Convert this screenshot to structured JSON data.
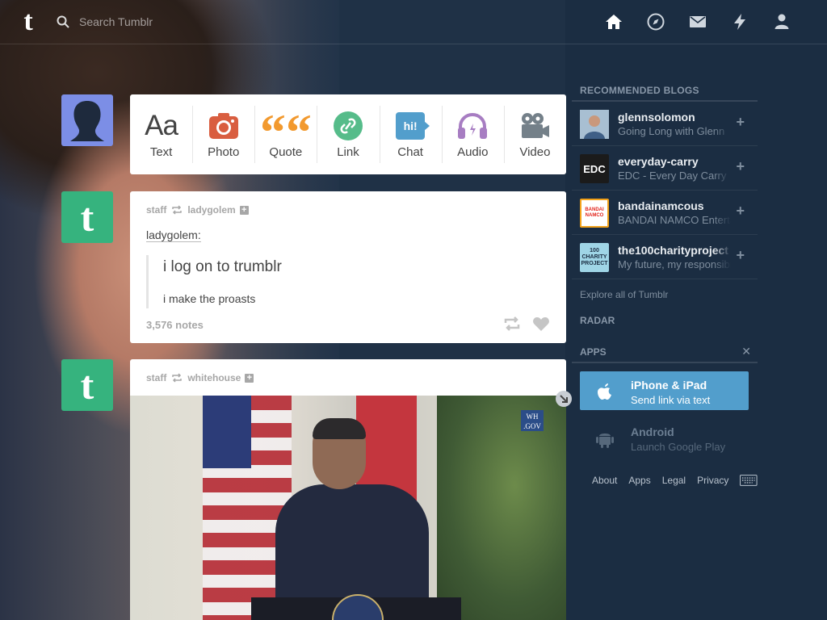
{
  "header": {
    "logo": "t",
    "search_placeholder": "Search Tumblr"
  },
  "nav": [
    "home-icon",
    "explore-icon",
    "inbox-icon",
    "activity-icon",
    "account-icon"
  ],
  "composer": {
    "types": [
      {
        "label": "Text",
        "icon": "Aa",
        "color": "#444444"
      },
      {
        "label": "Photo",
        "color": "#d95e40"
      },
      {
        "label": "Quote",
        "icon": "““",
        "color": "#f2992e"
      },
      {
        "label": "Link",
        "color": "#56bc8a"
      },
      {
        "label": "Chat",
        "icon": "hi!",
        "color": "#529ecc"
      },
      {
        "label": "Audio",
        "color": "#a77dc2"
      },
      {
        "label": "Video",
        "color": "#748089"
      }
    ]
  },
  "posts": [
    {
      "author": "staff",
      "reblogged_from": "ladygolem",
      "quote_user": "ladygolem:",
      "quote_big": "i log on to trumblr",
      "quote_small": "i make the proasts",
      "notes": "3,576 notes"
    },
    {
      "author": "staff",
      "reblogged_from": "whitehouse",
      "badge": "WH .GOV"
    }
  ],
  "sidebar": {
    "recommended_title": "RECOMMENDED BLOGS",
    "blogs": [
      {
        "name": "glennsolomon",
        "desc": "Going Long with Glenn",
        "avatar_text": "",
        "avatar_bg": "#8aa2b8"
      },
      {
        "name": "everyday-carry",
        "desc": "EDC - Every Day Carry",
        "avatar_text": "EDC",
        "avatar_bg": "#1b1b1b"
      },
      {
        "name": "bandainamcous",
        "desc": "BANDAI NAMCO Entertainment",
        "avatar_text": "BANDAI NAMCO",
        "avatar_bg": "#f3a21a"
      },
      {
        "name": "the100charityproject",
        "desc": "My future, my responsibility",
        "avatar_text": "100 CHARITY PROJECT",
        "avatar_bg": "#9fd5e6"
      }
    ],
    "explore": "Explore all of Tumblr",
    "radar_title": "RADAR",
    "apps_title": "APPS",
    "apps": [
      {
        "title": "iPhone & iPad",
        "subtitle": "Send link via text"
      },
      {
        "title": "Android",
        "subtitle": "Launch Google Play"
      }
    ],
    "footer": [
      "About",
      "Apps",
      "Legal",
      "Privacy"
    ]
  }
}
